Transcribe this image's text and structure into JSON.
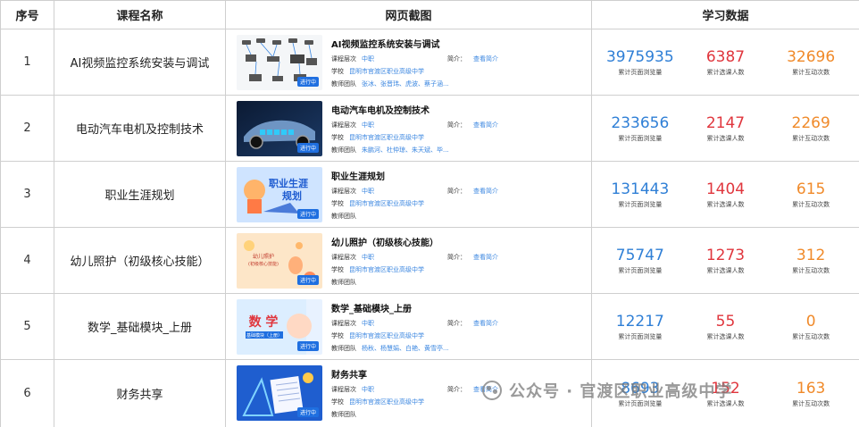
{
  "header": {
    "idx": "序号",
    "name": "课程名称",
    "screenshot": "网页截图",
    "stats": "学习数据"
  },
  "labels": {
    "level": "课程层次",
    "school": "学校",
    "team": "教师团队",
    "intro": "简介：",
    "view_intro": "查看简介",
    "views": "累计页面浏览量",
    "students": "累计选课人数",
    "interactions": "累计互动次数",
    "playing": "进行中"
  },
  "colors": {
    "views": "#2f7fd6",
    "students": "#e0363d",
    "interactions": "#f08a2a",
    "link": "#3a86e0"
  },
  "rows": [
    {
      "idx": "1",
      "name": "AI视频监控系统安装与调试",
      "title": "AI视频监控系统安装与调试",
      "level": "中职",
      "school": "昆明市官渡区职业高级中学",
      "team": "张冰、张晋玮、虎波、蔡子涵...",
      "views": "3975935",
      "students": "6387",
      "interactions": "32696",
      "thumb": "camera-network-diagram"
    },
    {
      "idx": "2",
      "name": "电动汽车电机及控制技术",
      "title": "电动汽车电机及控制技术",
      "level": "中职",
      "school": "昆明市官渡区职业高级中学",
      "team": "朱鹏河、杜仲琼、朱天斌、毕...",
      "views": "233656",
      "students": "2147",
      "interactions": "2269",
      "thumb": "electric-car"
    },
    {
      "idx": "3",
      "name": "职业生涯规划",
      "title": "职业生涯规划",
      "level": "中职",
      "school": "昆明市官渡区职业高级中学",
      "team": "",
      "views": "131443",
      "students": "1404",
      "interactions": "615",
      "thumb": "career-banner",
      "thumb_text": "职业生涯规划"
    },
    {
      "idx": "4",
      "name": "幼儿照护（初级核心技能）",
      "title": "幼儿照护（初级核心技能）",
      "level": "中职",
      "school": "昆明市官渡区职业高级中学",
      "team": "",
      "views": "75747",
      "students": "1273",
      "interactions": "312",
      "thumb": "childcare-banner",
      "thumb_text": "幼儿照护\n(初级核心技能)"
    },
    {
      "idx": "5",
      "name": "数学_基础模块_上册",
      "title": "数学_基础模块_上册",
      "level": "中职",
      "school": "昆明市官渡区职业高级中学",
      "team": "杨秋、杨慧娟、白艳、黄雪亭...",
      "views": "12217",
      "students": "55",
      "interactions": "0",
      "thumb": "math-banner",
      "thumb_text": "数 学",
      "thumb_sub": "基础模块（上册）"
    },
    {
      "idx": "6",
      "name": "财务共享",
      "title": "财务共享",
      "level": "中职",
      "school": "昆明市官渡区职业高级中学",
      "team": "",
      "views": "8693",
      "students": "152",
      "interactions": "163",
      "thumb": "finance-banner"
    }
  ],
  "watermark": "公众号 · 官渡区职业高级中学"
}
